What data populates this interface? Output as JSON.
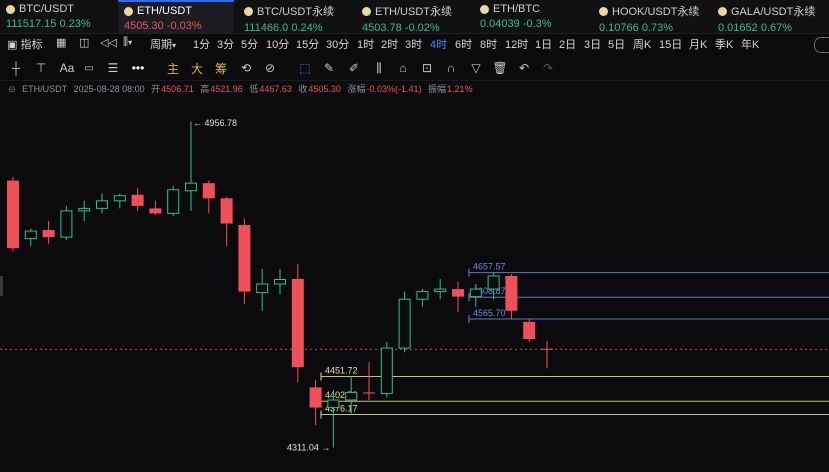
{
  "tabs": [
    {
      "name": "BTC/USDT",
      "price": "111517.15",
      "change": "0.23%",
      "dir": "up",
      "active": false
    },
    {
      "name": "ETH/USDT",
      "price": "4505.30",
      "change": "-0.03%",
      "dir": "down",
      "active": true
    },
    {
      "name": "BTC/USDT永续",
      "price": "111466.0",
      "change": "0.24%",
      "dir": "up",
      "active": false
    },
    {
      "name": "ETH/USDT永续",
      "price": "4503.78",
      "change": "-0.02%",
      "dir": "up",
      "active": false
    },
    {
      "name": "ETH/BTC",
      "price": "0.04039",
      "change": "-0.3%",
      "dir": "up",
      "active": false
    },
    {
      "name": "HOOK/USDT永续",
      "price": "0.10766",
      "change": "0.73%",
      "dir": "up",
      "active": false
    },
    {
      "name": "GALA/USDT永续",
      "price": "0.01652",
      "change": "0.67%",
      "dir": "up",
      "active": false
    }
  ],
  "toolbar": {
    "indicator_label": "指标",
    "period_label": "周期",
    "intervals": [
      "1分",
      "3分",
      "5分",
      "10分",
      "15分",
      "30分",
      "1时",
      "2时",
      "3时",
      "4时",
      "6时",
      "8时",
      "12时",
      "1日",
      "2日",
      "3日",
      "5日",
      "周K",
      "15日",
      "月K",
      "季K",
      "年K"
    ],
    "active_interval": "4时"
  },
  "drawing_tools": {
    "main_label": "主",
    "big_label": "大",
    "chip_label": "筹"
  },
  "info": {
    "symbol": "ETH/USDT",
    "datetime": "2025-08-28 08:00",
    "open_label": "开",
    "open": "4506.71",
    "high_label": "高",
    "high": "4521.96",
    "low_label": "低",
    "low": "4467.63",
    "close_label": "收",
    "close": "4505.30",
    "change_label": "涨幅",
    "change": "-0.03%(-1.41)",
    "amplitude_label": "振幅",
    "amplitude": "1.21%"
  },
  "colors": {
    "up": "#2fbf8a",
    "down": "#f0505a",
    "accent": "#3a8bff",
    "blue_level": "#6f86e8",
    "yellow_level": "#e8e08a"
  },
  "chart_data": {
    "type": "candlestick",
    "ylim": [
      4290,
      4990
    ],
    "candles": [
      {
        "o": 4840,
        "h": 4848,
        "l": 4700,
        "c": 4706
      },
      {
        "o": 4725,
        "h": 4745,
        "l": 4710,
        "c": 4740
      },
      {
        "o": 4742,
        "h": 4760,
        "l": 4715,
        "c": 4728
      },
      {
        "o": 4728,
        "h": 4790,
        "l": 4722,
        "c": 4780
      },
      {
        "o": 4780,
        "h": 4800,
        "l": 4760,
        "c": 4785
      },
      {
        "o": 4785,
        "h": 4815,
        "l": 4775,
        "c": 4800
      },
      {
        "o": 4800,
        "h": 4815,
        "l": 4785,
        "c": 4810
      },
      {
        "o": 4812,
        "h": 4825,
        "l": 4780,
        "c": 4790
      },
      {
        "o": 4785,
        "h": 4800,
        "l": 4772,
        "c": 4775
      },
      {
        "o": 4775,
        "h": 4830,
        "l": 4770,
        "c": 4822
      },
      {
        "o": 4820,
        "h": 4956.78,
        "l": 4780,
        "c": 4835
      },
      {
        "o": 4835,
        "h": 4840,
        "l": 4775,
        "c": 4805
      },
      {
        "o": 4805,
        "h": 4808,
        "l": 4710,
        "c": 4755
      },
      {
        "o": 4752,
        "h": 4765,
        "l": 4595,
        "c": 4620
      },
      {
        "o": 4618,
        "h": 4665,
        "l": 4582,
        "c": 4635
      },
      {
        "o": 4635,
        "h": 4665,
        "l": 4615,
        "c": 4644
      },
      {
        "o": 4645,
        "h": 4675,
        "l": 4440,
        "c": 4470
      },
      {
        "o": 4430,
        "h": 4445,
        "l": 4355,
        "c": 4390
      },
      {
        "o": 4390,
        "h": 4425,
        "l": 4311.04,
        "c": 4405
      },
      {
        "o": 4405,
        "h": 4451.72,
        "l": 4378,
        "c": 4420
      },
      {
        "o": 4420,
        "h": 4480,
        "l": 4405,
        "c": 4418
      },
      {
        "o": 4418,
        "h": 4520,
        "l": 4410,
        "c": 4508
      },
      {
        "o": 4508,
        "h": 4620,
        "l": 4500,
        "c": 4605
      },
      {
        "o": 4605,
        "h": 4625,
        "l": 4590,
        "c": 4620
      },
      {
        "o": 4620,
        "h": 4645,
        "l": 4605,
        "c": 4625
      },
      {
        "o": 4625,
        "h": 4640,
        "l": 4580,
        "c": 4610
      },
      {
        "o": 4610,
        "h": 4635,
        "l": 4590,
        "c": 4625
      },
      {
        "o": 4625,
        "h": 4657.57,
        "l": 4605,
        "c": 4651
      },
      {
        "o": 4651,
        "h": 4655,
        "l": 4565.7,
        "c": 4582
      },
      {
        "o": 4560,
        "h": 4565,
        "l": 4520,
        "c": 4526
      },
      {
        "o": 4506.71,
        "h": 4521.96,
        "l": 4467.63,
        "c": 4505.3
      }
    ],
    "current_price": 4505.3,
    "high_marker": {
      "value": "4956.78",
      "text": "← 4956.78"
    },
    "low_marker": {
      "value": "4311.04",
      "text": "4311.04 →"
    },
    "levels": [
      {
        "value": 4657.57,
        "label": "4657.57",
        "kind": "blue"
      },
      {
        "value": 4608.87,
        "label": "4608.87",
        "kind": "blue"
      },
      {
        "value": 4565.7,
        "label": "4565.70",
        "kind": "blue"
      },
      {
        "value": 4451.72,
        "label": "4451.72",
        "kind": "yellow"
      },
      {
        "value": 4402.58,
        "label": "4402.58",
        "kind": "yellow"
      },
      {
        "value": 4376.17,
        "label": "4376.17",
        "kind": "yellow"
      }
    ]
  }
}
